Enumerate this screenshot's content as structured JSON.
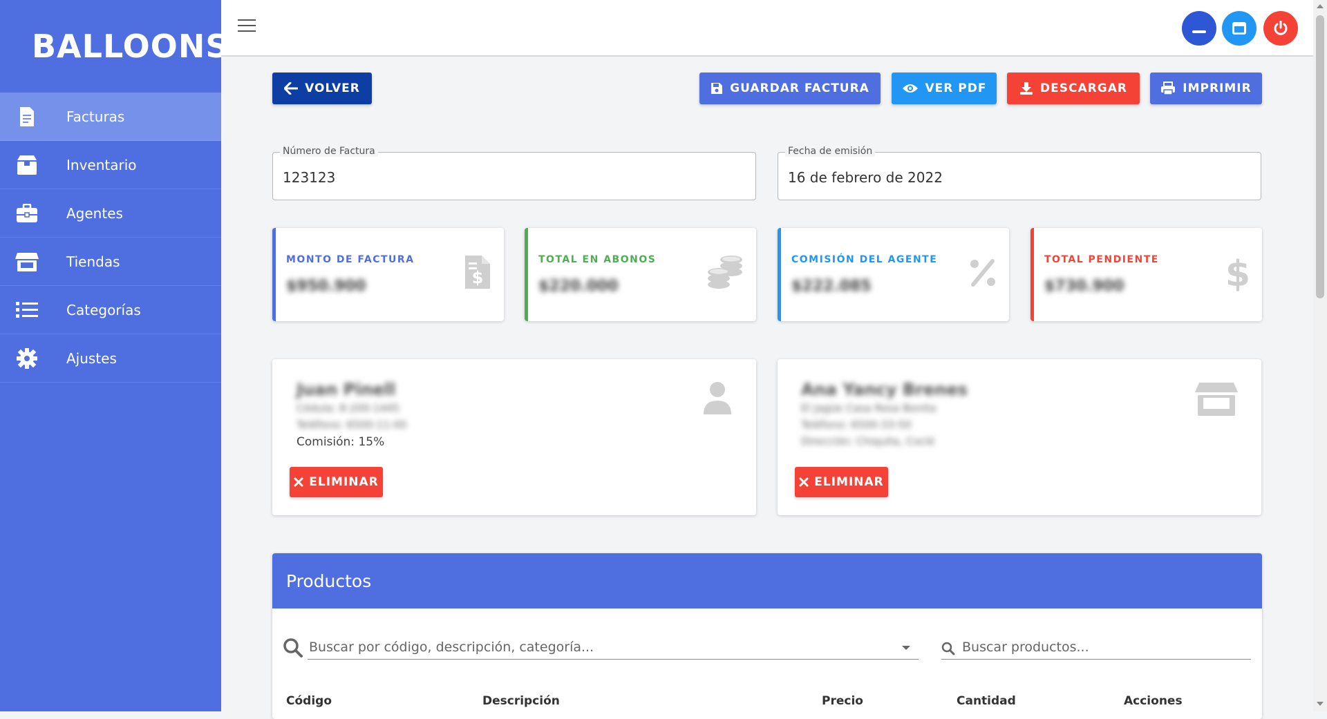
{
  "brand": {
    "name": "BALLOONS"
  },
  "sidebar": {
    "items": [
      {
        "label": "Facturas",
        "icon": "invoice-icon",
        "active": true
      },
      {
        "label": "Inventario",
        "icon": "box-icon"
      },
      {
        "label": "Agentes",
        "icon": "briefcase-icon"
      },
      {
        "label": "Tiendas",
        "icon": "store-icon"
      },
      {
        "label": "Categorías",
        "icon": "list-icon"
      },
      {
        "label": "Ajustes",
        "icon": "gear-icon"
      }
    ]
  },
  "toolbar": {
    "back": "VOLVER",
    "save": "GUARDAR FACTURA",
    "pdf": "VER PDF",
    "download": "DESCARGAR",
    "print": "IMPRIMIR"
  },
  "invoice": {
    "number_label": "Número de Factura",
    "number_value": "123123",
    "date_label": "Fecha de emisión",
    "date_value": "16 de febrero de 2022"
  },
  "stats": [
    {
      "title": "MONTO DE FACTURA",
      "value": "$950.900",
      "color": "#4f6fe0",
      "icon": "invoice-dollar-icon"
    },
    {
      "title": "TOTAL EN ABONOS",
      "value": "$220.000",
      "color": "#4caf50",
      "icon": "coins-icon"
    },
    {
      "title": "COMISIÓN DEL AGENTE",
      "value": "$222.085",
      "color": "#2196f3",
      "icon": "percent-icon"
    },
    {
      "title": "TOTAL PENDIENTE",
      "value": "$730.900",
      "color": "#f44336",
      "icon": "dollar-icon"
    }
  ],
  "agent": {
    "name": "Juan Pinell",
    "line1": "Cédula: 8-200-1445",
    "line2": "Teléfono: 6500-11-00",
    "commission": "Comisión: 15%",
    "delete": "ELIMINAR"
  },
  "store": {
    "name": "Ana Yancy Brenes",
    "line1": "El Jagüe Casa Rosa Bonita",
    "line2": "Teléfono: 6500-33-50",
    "line3": "Dirección: Chiquita, Coclé",
    "delete": "ELIMINAR"
  },
  "products": {
    "title": "Productos",
    "search_placeholder": "Buscar por código, descripción, categoría...",
    "search2_placeholder": "Buscar productos...",
    "columns": [
      "Código",
      "Descripción",
      "Precio",
      "Cantidad",
      "Acciones"
    ]
  },
  "colors": {
    "primary": "#4f6fe0",
    "dark_blue": "#0d3ea3",
    "info": "#2196f3",
    "danger": "#f44336",
    "success": "#4caf50"
  }
}
